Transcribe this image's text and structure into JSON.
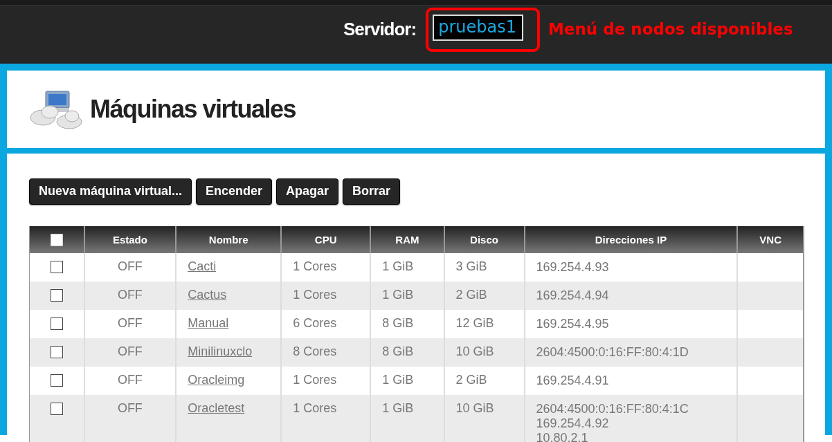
{
  "header": {
    "server_label": "Servidor:",
    "server_value": "pruebas1",
    "annotation": "Menú de nodos disponibles"
  },
  "page_title": "Máquinas virtuales",
  "buttons": [
    "Nueva máquina virtual...",
    "Encender",
    "Apagar",
    "Borrar"
  ],
  "table": {
    "select_all_checked": false,
    "columns": [
      "Estado",
      "Nombre",
      "CPU",
      "RAM",
      "Disco",
      "Direcciones IP",
      "VNC"
    ],
    "rows": [
      {
        "checked": false,
        "estado": "OFF",
        "nombre": "Cacti",
        "cpu": "1 Cores",
        "ram": "1 GiB",
        "disco": "3 GiB",
        "ips": [
          "169.254.4.93"
        ]
      },
      {
        "checked": false,
        "estado": "OFF",
        "nombre": "Cactus",
        "cpu": "1 Cores",
        "ram": "1 GiB",
        "disco": "2 GiB",
        "ips": [
          "169.254.4.94"
        ]
      },
      {
        "checked": false,
        "estado": "OFF",
        "nombre": "Manual",
        "cpu": "6 Cores",
        "ram": "8 GiB",
        "disco": "12 GiB",
        "ips": [
          "169.254.4.95"
        ]
      },
      {
        "checked": false,
        "estado": "OFF",
        "nombre": "Minilinuxclo",
        "cpu": "8 Cores",
        "ram": "8 GiB",
        "disco": "10 GiB",
        "ips": [
          "2604:4500:0:16:FF:80:4:1D"
        ]
      },
      {
        "checked": false,
        "estado": "OFF",
        "nombre": "Oracleimg",
        "cpu": "1 Cores",
        "ram": "1 GiB",
        "disco": "2 GiB",
        "ips": [
          "169.254.4.91"
        ]
      },
      {
        "checked": false,
        "estado": "OFF",
        "nombre": "Oracletest",
        "cpu": "1 Cores",
        "ram": "1 GiB",
        "disco": "10 GiB",
        "ips": [
          "2604:4500:0:16:FF:80:4:1C",
          "169.254.4.92",
          "10.80.2.1"
        ]
      }
    ]
  }
}
